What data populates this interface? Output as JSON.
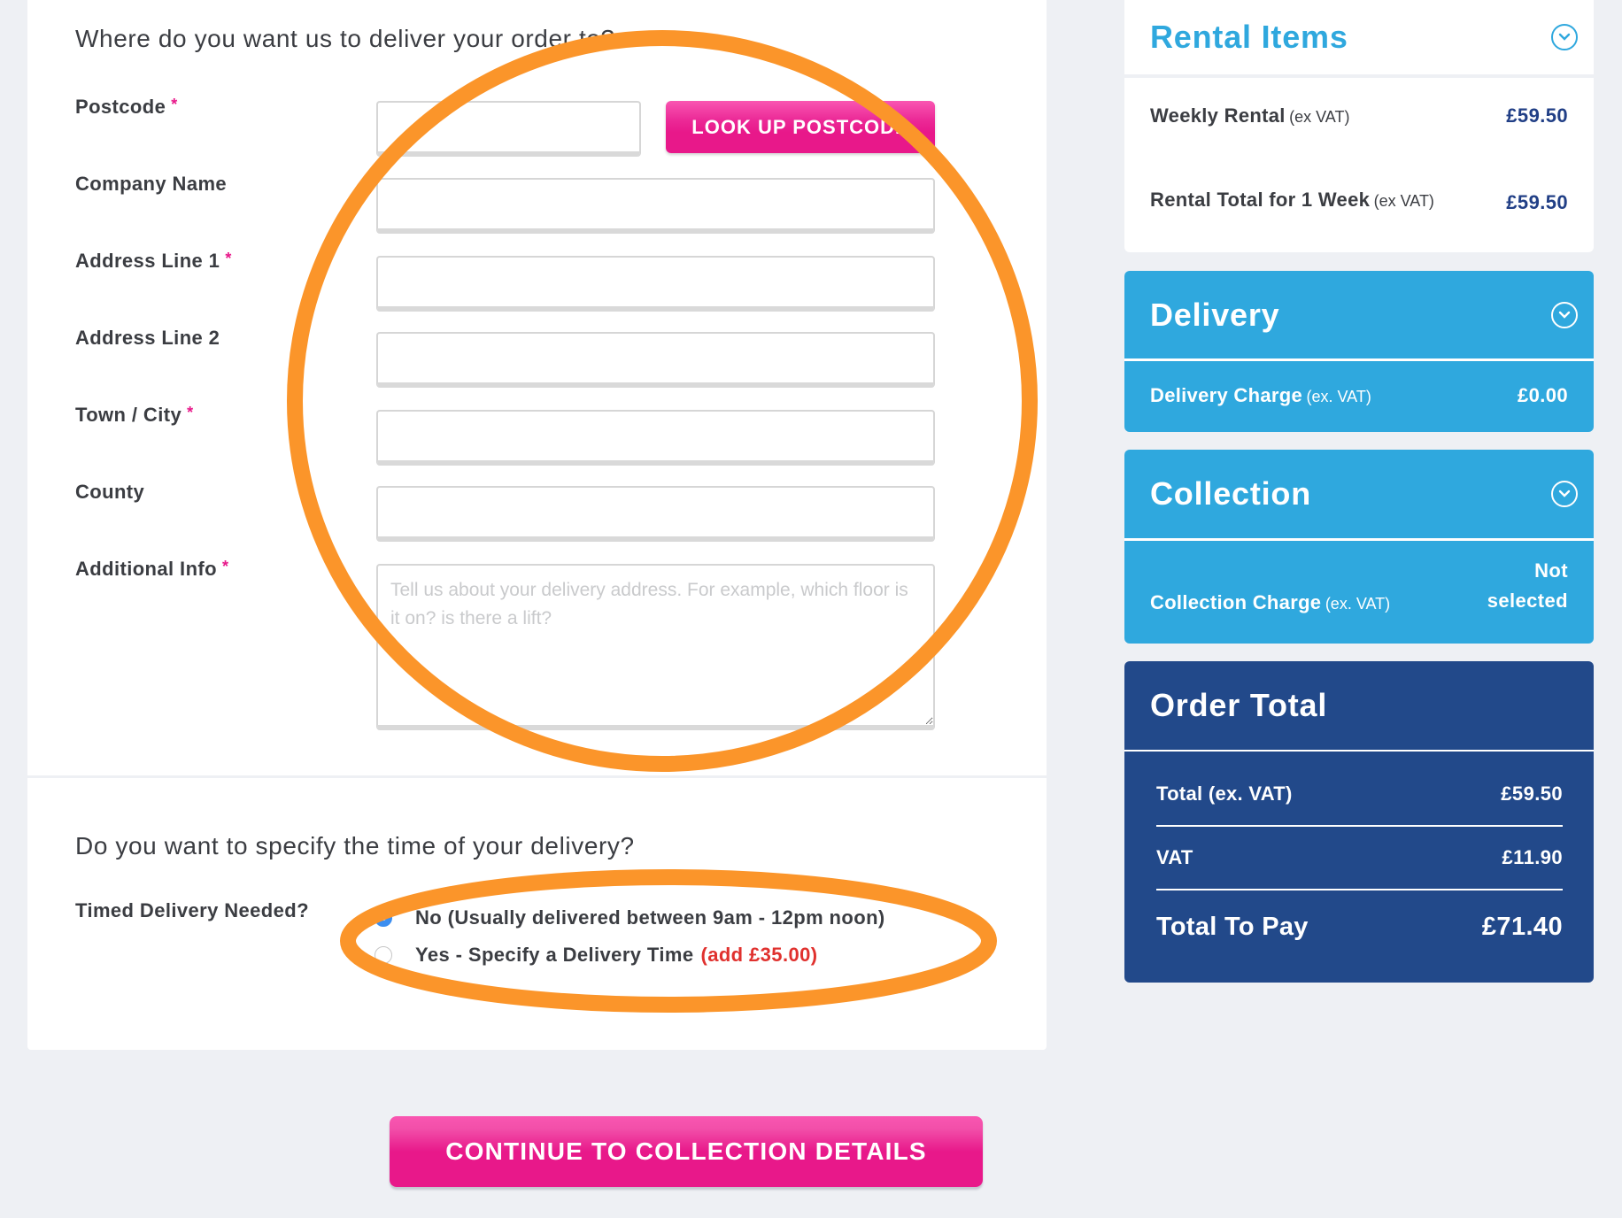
{
  "address_form": {
    "heading": "Where do you want us to deliver your order to?",
    "required_marker": "*",
    "fields": [
      {
        "label": "Postcode",
        "required": true,
        "value": "",
        "placeholder": ""
      },
      {
        "label": "Company Name",
        "required": false,
        "value": "",
        "placeholder": ""
      },
      {
        "label": "Address Line 1",
        "required": true,
        "value": "",
        "placeholder": ""
      },
      {
        "label": "Address Line 2",
        "required": false,
        "value": "",
        "placeholder": ""
      },
      {
        "label": "Town / City",
        "required": true,
        "value": "",
        "placeholder": ""
      },
      {
        "label": "County",
        "required": false,
        "value": "",
        "placeholder": ""
      },
      {
        "label": "Additional Info",
        "required": true,
        "value": "",
        "placeholder": "Tell us about your delivery address. For example, which floor is it on? is there a lift?"
      }
    ],
    "lookup_button": "LOOK UP POSTCODE"
  },
  "timed_delivery": {
    "heading": "Do you want to specify the time of your delivery?",
    "label": "Timed Delivery Needed?",
    "options": [
      {
        "label": "No (Usually delivered between 9am - 12pm noon)",
        "extra": "",
        "checked": true
      },
      {
        "label": "Yes - Specify a Delivery Time",
        "extra": "(add £35.00)",
        "checked": false
      }
    ]
  },
  "continue_button": "CONTINUE TO COLLECTION DETAILS",
  "sidebar": {
    "rental": {
      "title": "Rental Items",
      "rows": [
        {
          "label": "Weekly Rental",
          "note": "(ex VAT)",
          "value": "£59.50"
        },
        {
          "label": "Rental Total for 1 Week",
          "note": "(ex VAT)",
          "value": "£59.50"
        }
      ]
    },
    "delivery": {
      "title": "Delivery",
      "row": {
        "label": "Delivery Charge",
        "note": "(ex. VAT)",
        "value": "£0.00"
      }
    },
    "collection": {
      "title": "Collection",
      "row": {
        "label": "Collection Charge",
        "note": "(ex. VAT)",
        "value_line1": "Not",
        "value_line2": "selected"
      }
    },
    "order_total": {
      "title": "Order Total",
      "rows": [
        {
          "label": "Total (ex. VAT)",
          "value": "£59.50"
        },
        {
          "label": "VAT",
          "value": "£11.90"
        },
        {
          "label": "Total To Pay",
          "value": "£71.40"
        }
      ]
    }
  },
  "colors": {
    "brand_pink": "#e8188a",
    "sky_blue": "#2fa8de",
    "navy": "#22498a",
    "annotation_orange": "#fb952a",
    "price_red": "#e0312e",
    "radio_blue": "#3b8ef0"
  }
}
